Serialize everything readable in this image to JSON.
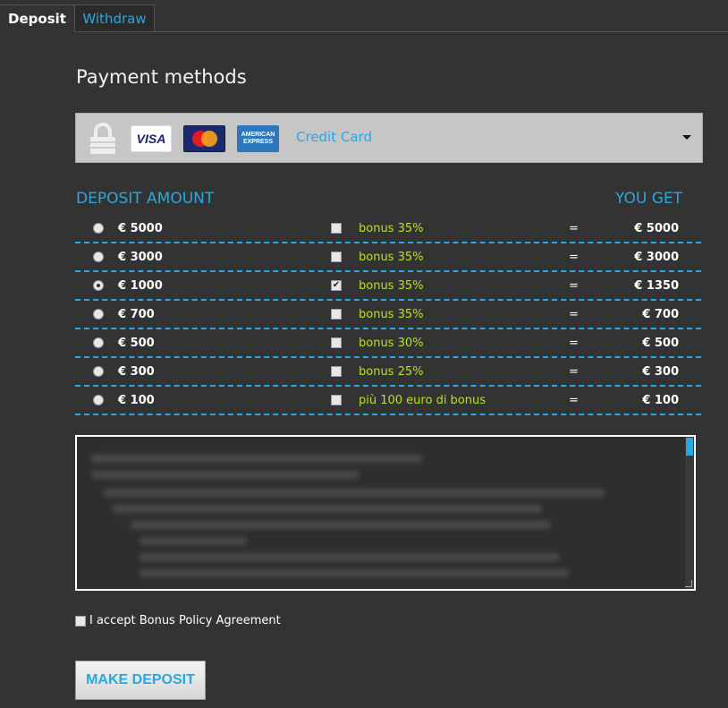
{
  "tabs": [
    {
      "label": "Deposit"
    },
    {
      "label": "Withdraw"
    }
  ],
  "page_title": "Payment methods",
  "payment_method": {
    "selected": "Credit Card",
    "cards": [
      "VISA",
      "MasterCard",
      "AMERICAN EXPRESS"
    ]
  },
  "headers": {
    "deposit_amount": "DEPOSIT AMOUNT",
    "you_get": "YOU GET"
  },
  "rows": [
    {
      "amount": "€ 5000",
      "bonus": "bonus 35%",
      "eq": "=",
      "get": "€ 5000",
      "selected": false,
      "bonus_checked": false
    },
    {
      "amount": "€ 3000",
      "bonus": "bonus 35%",
      "eq": "=",
      "get": "€ 3000",
      "selected": false,
      "bonus_checked": false
    },
    {
      "amount": "€ 1000",
      "bonus": "bonus 35%",
      "eq": "=",
      "get": "€ 1350",
      "selected": true,
      "bonus_checked": true
    },
    {
      "amount": "€ 700",
      "bonus": "bonus 35%",
      "eq": "=",
      "get": "€ 700",
      "selected": false,
      "bonus_checked": false
    },
    {
      "amount": "€ 500",
      "bonus": "bonus 30%",
      "eq": "=",
      "get": "€ 500",
      "selected": false,
      "bonus_checked": false
    },
    {
      "amount": "€ 300",
      "bonus": "bonus 25%",
      "eq": "=",
      "get": "€ 300",
      "selected": false,
      "bonus_checked": false
    },
    {
      "amount": "€ 100",
      "bonus": "più 100 euro di bonus",
      "eq": "=",
      "get": "€ 100",
      "selected": false,
      "bonus_checked": false
    }
  ],
  "accept_label": "I accept Bonus Policy Agreement",
  "submit_label": "MAKE DEPOSIT",
  "colors": {
    "accent": "#29a8e0",
    "bonus": "#b4e61e",
    "background": "#333333"
  }
}
